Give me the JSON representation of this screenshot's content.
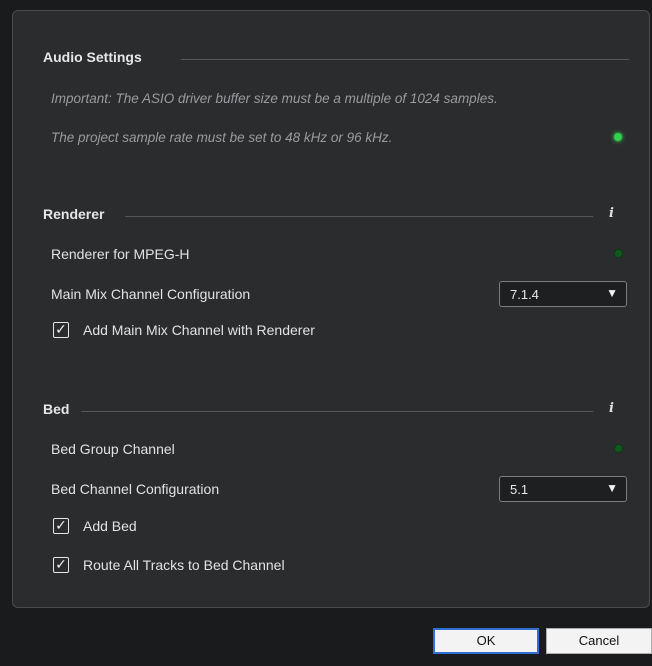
{
  "audio_settings": {
    "title": "Audio Settings",
    "note_buffer": "Important: The ASIO driver buffer size must be a multiple of 1024 samples.",
    "note_rate": "The project sample rate must be set to 48 kHz or 96 kHz.",
    "rate_led": "on"
  },
  "renderer": {
    "title": "Renderer",
    "info_icon": "i",
    "renderer_label": "Renderer for MPEG-H",
    "renderer_led": "off",
    "main_mix_label": "Main Mix Channel Configuration",
    "main_mix_value": "7.1.4",
    "add_main_mix_label": "Add Main Mix Channel with Renderer",
    "add_main_mix_checked": true
  },
  "bed": {
    "title": "Bed",
    "info_icon": "i",
    "group_label": "Bed Group Channel",
    "group_led": "off",
    "config_label": "Bed Channel Configuration",
    "config_value": "5.1",
    "add_bed_label": "Add Bed",
    "add_bed_checked": true,
    "route_label": "Route All Tracks to Bed Channel",
    "route_checked": true
  },
  "buttons": {
    "ok": "OK",
    "cancel": "Cancel"
  },
  "glyphs": {
    "check": "✓",
    "dropdown_arrow": "▼"
  },
  "colors": {
    "led_on": "#2fd24a",
    "led_off": "#0f5a1c",
    "ok_focus": "#2f6fd6"
  }
}
